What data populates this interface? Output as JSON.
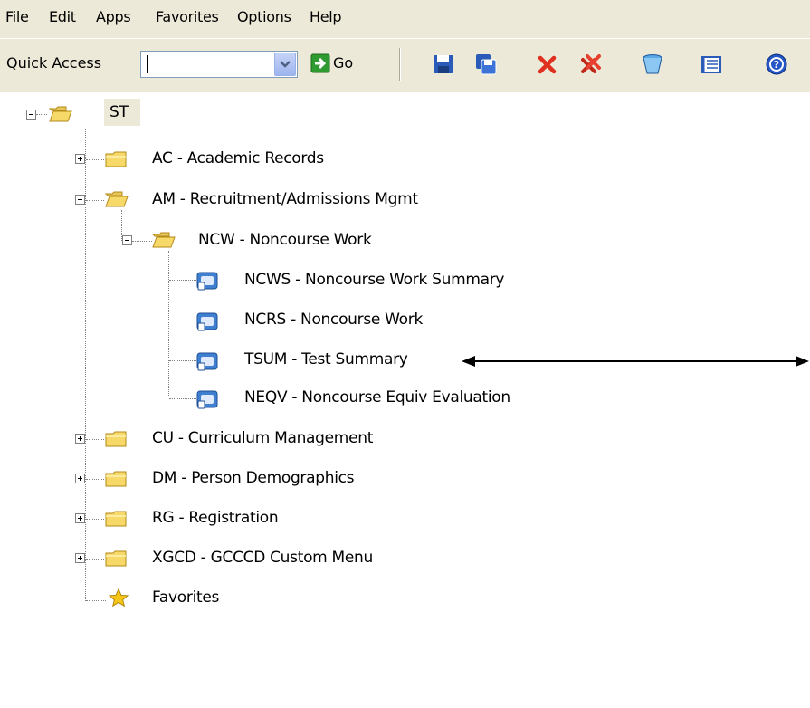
{
  "menu": {
    "items": [
      {
        "label": "File"
      },
      {
        "label": "Edit"
      },
      {
        "label": "Apps"
      },
      {
        "label": "Favorites"
      },
      {
        "label": "Options"
      },
      {
        "label": "Help"
      }
    ]
  },
  "toolbar": {
    "quick_access_label": "Quick Access",
    "quick_access_value": "",
    "go_label": "Go",
    "icons": [
      "save-icon",
      "save-as-icon",
      "delete-icon",
      "delete-all-icon",
      "clear-icon",
      "list-view-icon",
      "help-icon"
    ]
  },
  "tree": {
    "root": "ST",
    "nodes": [
      {
        "label": "AC - Academic Records"
      },
      {
        "label": "AM - Recruitment/Admissions Mgmt"
      },
      {
        "label": "NCW - Noncourse Work"
      },
      {
        "label": "NCWS - Noncourse Work Summary"
      },
      {
        "label": "NCRS - Noncourse Work"
      },
      {
        "label": "TSUM - Test Summary"
      },
      {
        "label": "NEQV - Noncourse Equiv Evaluation"
      },
      {
        "label": "CU - Curriculum Management"
      },
      {
        "label": "DM - Person Demographics"
      },
      {
        "label": "RG - Registration"
      },
      {
        "label": "XGCD - GCCCD Custom Menu"
      },
      {
        "label": "Favorites"
      }
    ]
  },
  "colors": {
    "chrome": "#ece9d8",
    "folder": "#f7d96a",
    "accent_red": "#e03020",
    "accent_blue": "#2a5bb8"
  }
}
